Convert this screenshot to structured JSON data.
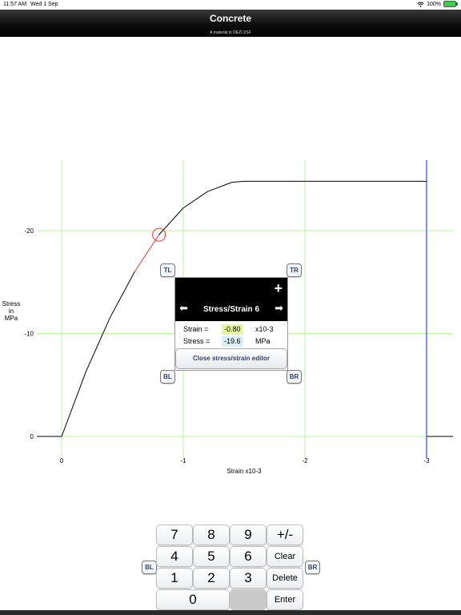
{
  "status_bar": {
    "time": "11:57 AM",
    "date": "Wed 1 Sep",
    "battery": "100%",
    "wifi_icon": "wifi-icon",
    "battery_icon": "battery-charging-icon"
  },
  "header": {
    "title": "Concrete",
    "subtitle": "A material in DEZI.XSF"
  },
  "chart": {
    "ylabel_lines": [
      "Stress",
      "in",
      "MPa"
    ],
    "xlabel": "Strain x10-3",
    "x_ticks": [
      "0",
      "-1",
      "-2",
      "-3"
    ],
    "y_ticks": [
      "-20",
      "-10",
      "0"
    ],
    "grid_color": "#b9f59a",
    "curve_color": "#000000",
    "highlight_color": "#ff3333",
    "limit_line_color": "#3355ff"
  },
  "chart_data": {
    "type": "line",
    "xlabel": "Strain x10-3",
    "ylabel": "Stress in MPa",
    "xlim": [
      0,
      -3.2
    ],
    "ylim": [
      0,
      -26
    ],
    "grid": true,
    "series": [
      {
        "x": [
          0,
          -0.2,
          -0.4,
          -0.6,
          -0.8,
          -1.0,
          -1.2,
          -1.4,
          -1.5,
          -2.0,
          -2.5,
          -3.0
        ],
        "y": [
          0,
          -6.3,
          -11.6,
          -16.0,
          -19.6,
          -22.2,
          -23.8,
          -24.7,
          -24.8,
          -24.8,
          -24.8,
          -24.8
        ]
      }
    ],
    "highlighted_point": {
      "x": -0.8,
      "y": -19.6
    },
    "limit_x": -3.0
  },
  "corner_buttons": {
    "tl": "TL",
    "tr": "TR",
    "bl": "BL",
    "br": "BR"
  },
  "editor": {
    "plus": "+",
    "prev_arrow": "⬅",
    "next_arrow": "➡",
    "title": "Stress/Strain 6",
    "strain_label": "Strain =",
    "strain_value": "-0.80",
    "strain_unit": "x10-3",
    "stress_label": "Stress =",
    "stress_value": "-19.6",
    "stress_unit": "MPa",
    "close_label": "Close stress/strain editor",
    "strain_highlight": "#e8f6a0",
    "stress_highlight": "#d8eef8"
  },
  "keypad": {
    "keys": [
      "7",
      "8",
      "9",
      "+/-",
      "4",
      "5",
      "6",
      "Clear",
      "1",
      "2",
      "3",
      "Delete",
      "0",
      "Enter"
    ],
    "side_left": "BL",
    "side_right": "BR"
  }
}
